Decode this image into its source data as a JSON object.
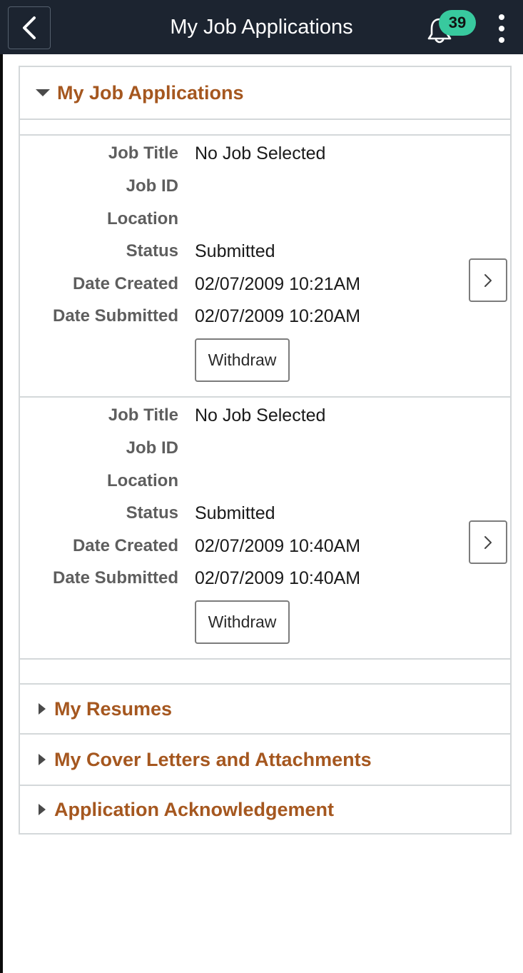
{
  "header": {
    "title": "My Job Applications",
    "notification_count": "39"
  },
  "sections": {
    "job_applications": {
      "title": "My Job Applications"
    },
    "resumes": {
      "title": "My Resumes"
    },
    "cover_letters": {
      "title": "My Cover Letters and Attachments"
    },
    "acknowledgement": {
      "title": "Application Acknowledgement"
    }
  },
  "labels": {
    "job_title": "Job Title",
    "job_id": "Job ID",
    "location": "Location",
    "status": "Status",
    "date_created": "Date Created",
    "date_submitted": "Date Submitted",
    "withdraw": "Withdraw"
  },
  "applications": [
    {
      "job_title": "No Job Selected",
      "job_id": "",
      "location": "",
      "status": "Submitted",
      "date_created": "02/07/2009 10:21AM",
      "date_submitted": "02/07/2009 10:20AM"
    },
    {
      "job_title": "No Job Selected",
      "job_id": "",
      "location": "",
      "status": "Submitted",
      "date_created": "02/07/2009 10:40AM",
      "date_submitted": "02/07/2009 10:40AM"
    }
  ],
  "icons": {
    "back": "chevron-left-icon",
    "notifications": "bell-icon",
    "menu": "kebab-menu-icon",
    "expanded": "caret-down-icon",
    "collapsed": "caret-right-icon",
    "detail": "chevron-right-icon"
  },
  "colors": {
    "header_bg": "#1c2430",
    "section_title": "#a5571f",
    "badge": "#38c99e",
    "border": "#d4d8da"
  }
}
